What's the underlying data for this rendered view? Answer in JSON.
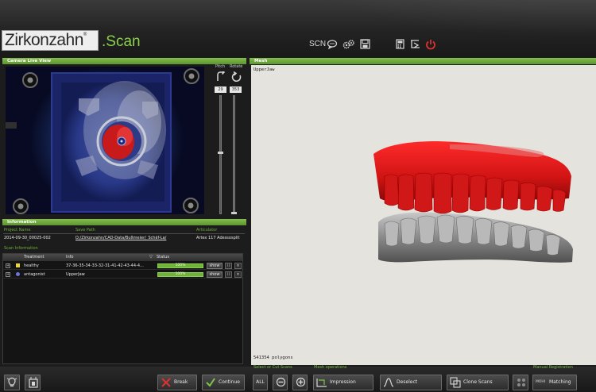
{
  "app": {
    "logo_text": "Zirkonzahn",
    "logo_reg": "®",
    "logo_suffix": ".Scan"
  },
  "toolbar": {
    "scn_label": "SCN",
    "icons": [
      "chat-icon",
      "gears-icon",
      "save-icon",
      "calculator-icon",
      "export-icon",
      "power-icon"
    ]
  },
  "camera_panel": {
    "title": "Camera Live View",
    "pitch_label": "Pitch",
    "rotate_label": "Rotate",
    "pitch_value": "29",
    "rotate_value": "353"
  },
  "information": {
    "title": "Information",
    "project_name_label": "Project Name",
    "project_name": "2014-09-30_00025-002",
    "save_path_label": "Save Path",
    "save_path": "D:/Zirkonzahn/CAD-Data/Bußmeier/_Schäf-La/",
    "articulator_label": "Articulator",
    "articulator": "Artex 117 Adessosplit",
    "scan_info_label": "Scan Information"
  },
  "scan_table": {
    "columns": [
      "Treatment",
      "Info",
      "Status"
    ],
    "rows": [
      {
        "treatment": "healthy",
        "info": "37-36-35-34-33-32-31-41-42-43-44-4...",
        "status": "100%",
        "progress": 1.0,
        "show": "show",
        "color": "#e8d640"
      },
      {
        "treatment": "antagonist",
        "info": "UpperJaw",
        "status": "100%",
        "progress": 1.0,
        "show": "show",
        "color": "#6f74d8"
      }
    ]
  },
  "mesh_panel": {
    "title": "Mesh",
    "jaw_label": "UpperJaw",
    "polygons": "541354 polygons"
  },
  "bottom": {
    "select_label": "Select or Cut Scans",
    "all_label": "ALL",
    "mesh_ops_label": "Mesh operations",
    "impression": "Impression",
    "deselect": "Deselect",
    "clone": "Clone Scans",
    "manual_reg_label": "Manual Registration",
    "matching": "Matching",
    "matching_prefix": "MOHI",
    "break": "Break",
    "continue": "Continue"
  },
  "colors": {
    "accent_green": "#6fae3d",
    "model_red": "#d11414",
    "model_gray": "#7a7a7a",
    "power_red": "#e03030"
  }
}
